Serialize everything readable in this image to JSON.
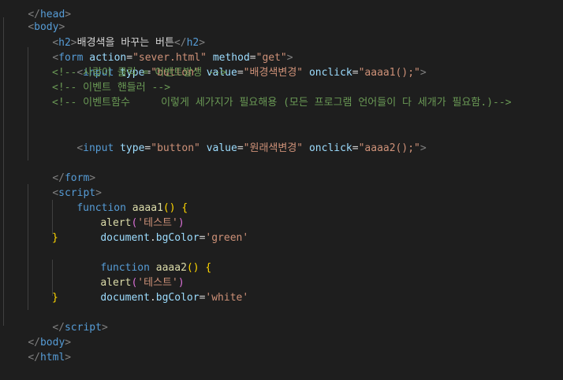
{
  "lines": {
    "head_close": "</head>",
    "body_open": "<body>",
    "h2_text": "배경색을 바꾸는 버튼",
    "form_action": "\"sever.html\"",
    "form_method": "\"get\"",
    "input1_type": "\"button\"",
    "input1_value": "\"배경색변경\"",
    "input1_onclick": "\"aaaa1();\"",
    "comment1": "<!-- 사람이 클릭 = 이벤트발생 -->",
    "comment2": "<!-- 이벤트 핸들러 -->",
    "comment3": "<!-- 이벤트함수     이렇게 세가지가 필요해용 (모든 프로그램 언어들이 다 세개가 필요함.)-->",
    "input2_type": "\"button\"",
    "input2_value": "\"원래색변경\"",
    "input2_onclick": "\"aaaa2();\"",
    "fn1_name": "aaaa1",
    "alert1_arg": "'테스트'",
    "bg1_value": "'green'",
    "fn2_name": "aaaa2",
    "alert2_arg": "'테스트'",
    "bg2_value": "'white'"
  },
  "keywords": {
    "function": "function",
    "alert": "alert",
    "document": "document",
    "bgColor": "bgColor"
  },
  "theme": {
    "background": "#1e1e1e",
    "tag": "#569cd6",
    "attribute": "#9cdcfe",
    "string": "#ce9178",
    "comment": "#6a9955",
    "function_name": "#dcdcaa",
    "brace": "#ffd700"
  }
}
